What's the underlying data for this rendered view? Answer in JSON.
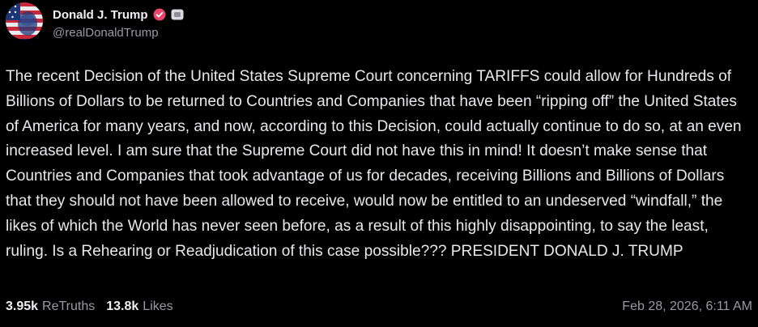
{
  "author": {
    "display_name": "Donald J. Trump",
    "handle": "@realDonaldTrump",
    "avatar_icon": "avatar-flag-portrait",
    "verified_icon": "verified-badge-icon",
    "badge_icon": "account-badge-icon"
  },
  "post": {
    "text": "The recent Decision of the United States Supreme Court concerning TARIFFS could allow for Hundreds of Billions of Dollars to be returned to Countries and Companies that have been “ripping off” the United States of America for many years, and now, according to this Decision, could actually continue to do so, at an even increased level. I am sure that the Supreme Court did not have this in mind! It doesn’t make sense that Countries and Companies that took advantage of us for decades, receiving Billions and Billions of Dollars that they should not have been allowed to receive, would now be entitled to an undeserved “windfall,” the likes of which the World has never seen before, as a result of this highly disappointing, to say the least, ruling. Is a Rehearing or Readjudication of this case possible??? PRESIDENT DONALD J. TRUMP"
  },
  "stats": {
    "retruths_count": "3.95k",
    "retruths_label": "ReTruths",
    "likes_count": "13.8k",
    "likes_label": "Likes"
  },
  "timestamp": "Feb 28, 2026, 6:11 AM",
  "colors": {
    "background": "#000000",
    "text": "#e9e9ec",
    "muted": "#9a9aa2",
    "verified": "#e8466a"
  }
}
